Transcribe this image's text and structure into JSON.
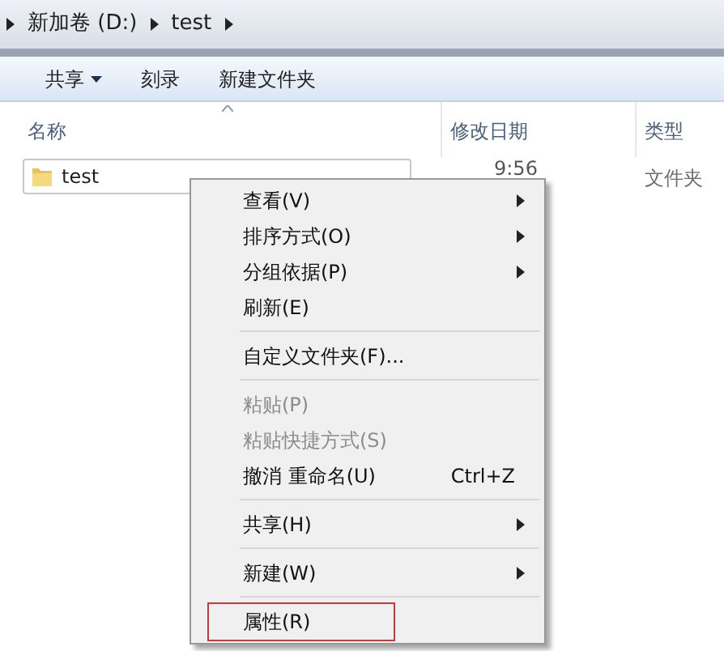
{
  "breadcrumb": [
    "新加卷 (D:)",
    "test"
  ],
  "toolbar": [
    {
      "label": "共享",
      "dropdown": true
    },
    {
      "label": "刻录",
      "dropdown": false
    },
    {
      "label": "新建文件夹",
      "dropdown": false
    }
  ],
  "columns": [
    "名称",
    "修改日期",
    "类型"
  ],
  "rows": [
    {
      "name": "test",
      "date": "9:56",
      "type": "文件夹",
      "selected": true
    }
  ],
  "context_menu": [
    {
      "kind": "item",
      "label": "查看(V)",
      "submenu": true,
      "disabled": false
    },
    {
      "kind": "item",
      "label": "排序方式(O)",
      "submenu": true,
      "disabled": false
    },
    {
      "kind": "item",
      "label": "分组依据(P)",
      "submenu": true,
      "disabled": false
    },
    {
      "kind": "item",
      "label": "刷新(E)",
      "submenu": false,
      "disabled": false
    },
    {
      "kind": "separator"
    },
    {
      "kind": "item",
      "label": "自定义文件夹(F)...",
      "submenu": false,
      "disabled": false
    },
    {
      "kind": "separator"
    },
    {
      "kind": "item",
      "label": "粘贴(P)",
      "submenu": false,
      "disabled": true
    },
    {
      "kind": "item",
      "label": "粘贴快捷方式(S)",
      "submenu": false,
      "disabled": true
    },
    {
      "kind": "item",
      "label": "撤消 重命名(U)",
      "shortcut": "Ctrl+Z",
      "submenu": false,
      "disabled": false
    },
    {
      "kind": "separator"
    },
    {
      "kind": "item",
      "label": "共享(H)",
      "submenu": true,
      "disabled": false
    },
    {
      "kind": "separator"
    },
    {
      "kind": "item",
      "label": "新建(W)",
      "submenu": true,
      "disabled": false
    },
    {
      "kind": "separator"
    },
    {
      "kind": "item",
      "label": "属性(R)",
      "submenu": false,
      "disabled": false,
      "highlighted": true
    }
  ]
}
